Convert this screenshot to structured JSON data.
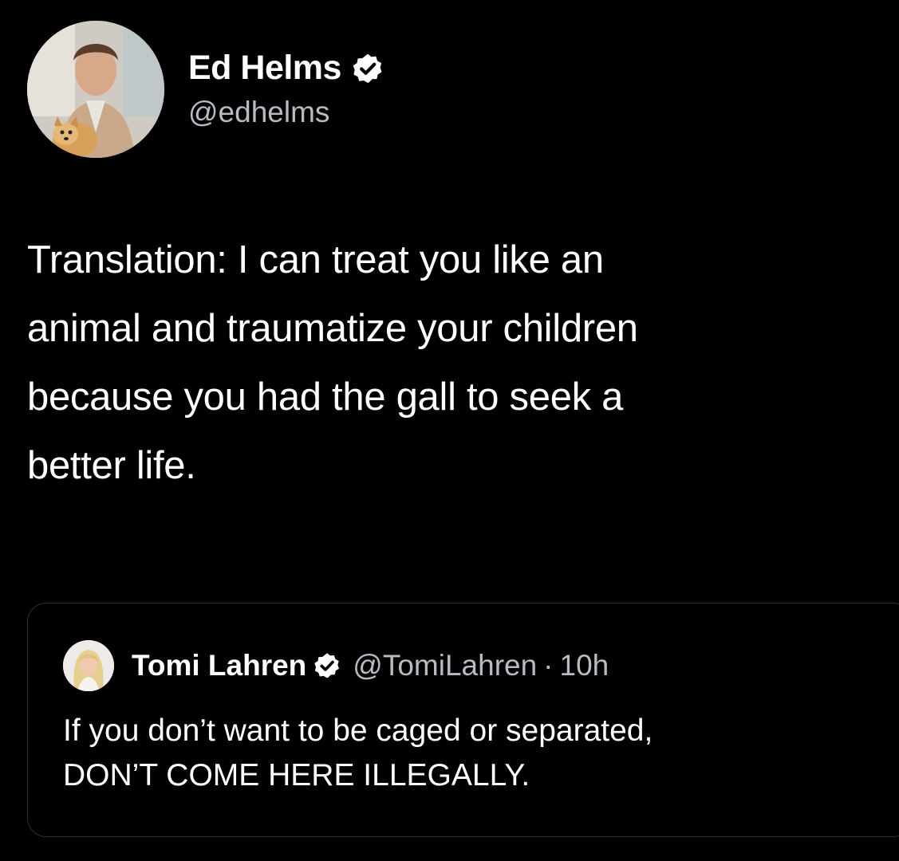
{
  "tweet": {
    "author": {
      "display_name": "Ed Helms",
      "handle": "@edhelms",
      "verified_icon": "verified-badge-icon"
    },
    "text": "Translation: I can treat you like an\nanimal and traumatize your children\nbecause you had the gall to seek a\nbetter life."
  },
  "quoted_tweet": {
    "author": {
      "display_name": "Tomi Lahren",
      "handle": "@TomiLahren",
      "verified_icon": "verified-badge-icon"
    },
    "separator": "·",
    "time": "10h",
    "text": "If you don’t want to be caged or separated,\nDON’T COME HERE ILLEGALLY."
  },
  "colors": {
    "background": "#000000",
    "primary_text": "#ffffff",
    "secondary_text": "#b6bcc2",
    "card_border": "#2c3035"
  }
}
